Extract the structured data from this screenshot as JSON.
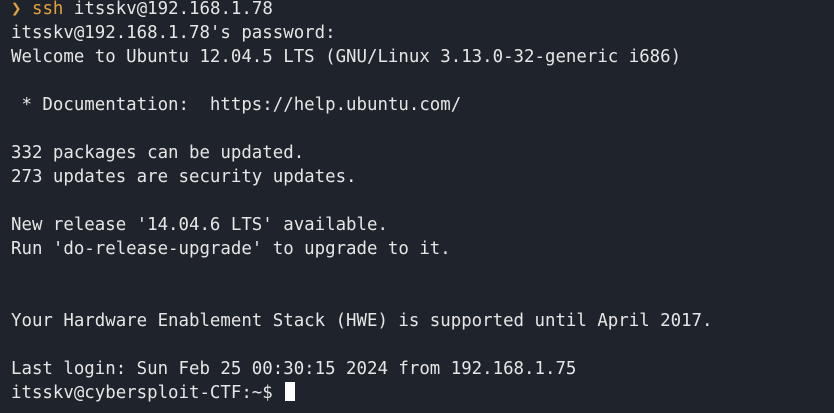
{
  "colors": {
    "background": "#1f232b",
    "text": "#e6e6e6",
    "command_accent": "#e5a13d",
    "cursor": "#ffffff"
  },
  "command": {
    "prompt_glyph": "❯",
    "name": "ssh",
    "args": "itsskv@192.168.1.78"
  },
  "output": {
    "password_prompt": "itsskv@192.168.1.78's password:",
    "welcome": "Welcome to Ubuntu 12.04.5 LTS (GNU/Linux 3.13.0-32-generic i686)",
    "documentation": " * Documentation:  https://help.ubuntu.com/",
    "packages": "332 packages can be updated.",
    "security_updates": "273 updates are security updates.",
    "new_release": "New release '14.04.6 LTS' available.",
    "upgrade_hint": "Run 'do-release-upgrade' to upgrade to it.",
    "hwe_notice": "Your Hardware Enablement Stack (HWE) is supported until April 2017.",
    "last_login": "Last login: Sun Feb 25 00:30:15 2024 from 192.168.1.75",
    "shell_prompt": "itsskv@cybersploit-CTF:~$ "
  }
}
